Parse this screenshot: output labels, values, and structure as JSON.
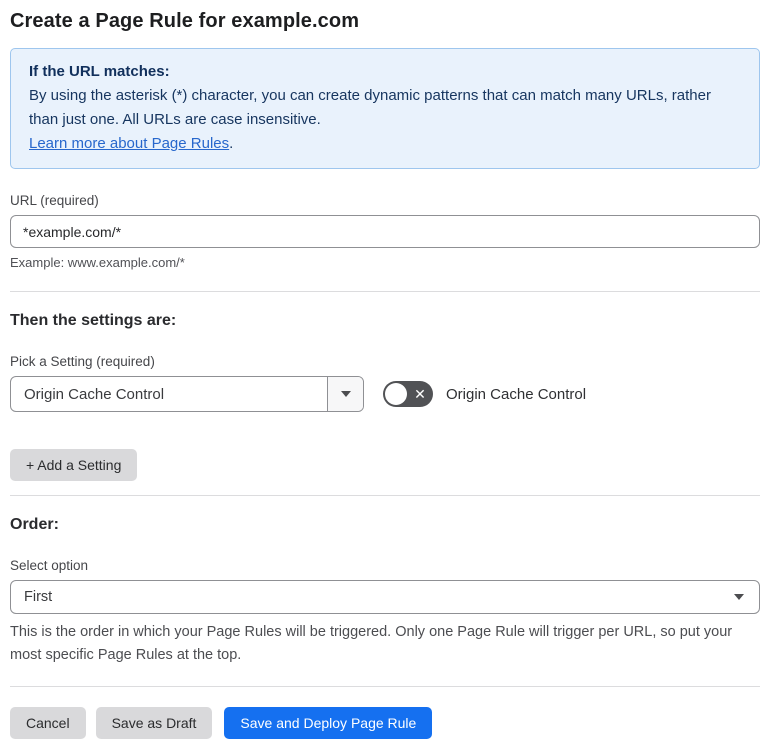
{
  "page": {
    "title": "Create a Page Rule for example.com"
  },
  "info_box": {
    "heading": "If the URL matches:",
    "body": "By using the asterisk (*) character, you can create dynamic patterns that can match many URLs, rather than just one. All URLs are case insensitive.",
    "link_label": "Learn more about Page Rules",
    "link_suffix": "."
  },
  "url_section": {
    "label": "URL (required)",
    "input_value": "*example.com/*",
    "helper": "Example: www.example.com/*"
  },
  "settings_section": {
    "heading": "Then the settings are:",
    "pick_label": "Pick a Setting (required)",
    "selected_setting": "Origin Cache Control",
    "toggle_label": "Origin Cache Control",
    "toggle_state": "off",
    "toggle_icon": "✕",
    "add_setting_label": "+ Add a Setting"
  },
  "order_section": {
    "heading": "Order:",
    "select_label": "Select option",
    "selected_option": "First",
    "helper": "This is the order in which your Page Rules will be triggered. Only one Page Rule will trigger per URL, so put your most specific Page Rules at the top."
  },
  "footer": {
    "cancel_label": "Cancel",
    "save_draft_label": "Save as Draft",
    "save_deploy_label": "Save and Deploy Page Rule"
  },
  "colors": {
    "info_box_background": "#e9f2fc",
    "info_box_border": "#9ec6ee",
    "info_box_text": "#16355f",
    "link_blue": "#2767cc",
    "toggle_off_background": "#515255",
    "primary_button_blue": "#1570f0",
    "secondary_button_gray": "#d9d9db"
  }
}
